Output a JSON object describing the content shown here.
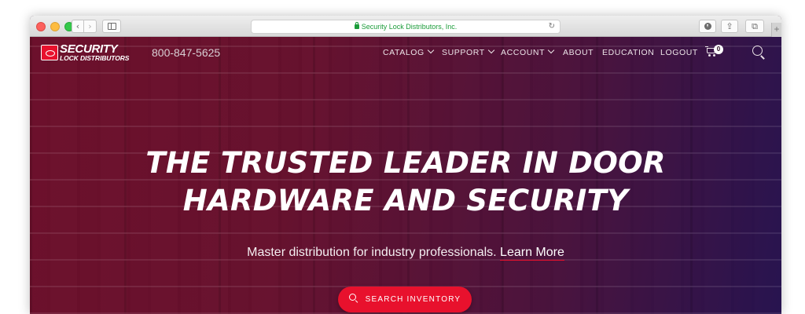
{
  "browser": {
    "url_text": "Security Lock Distributors, Inc.",
    "back_glyph": "‹",
    "forward_glyph": "›",
    "reload_glyph": "↻",
    "share_glyph": "⇪",
    "tabs_glyph": "⧉",
    "new_tab_glyph": "+"
  },
  "header": {
    "logo_top": "SECURITY",
    "logo_bottom": "LOCK DISTRIBUTORS",
    "phone": "800-847-5625",
    "nav": [
      {
        "label": "CATALOG",
        "has_dropdown": true
      },
      {
        "label": "SUPPORT",
        "has_dropdown": true
      },
      {
        "label": "ACCOUNT",
        "has_dropdown": true
      },
      {
        "label": "ABOUT",
        "has_dropdown": false
      },
      {
        "label": "EDUCATION",
        "has_dropdown": false
      },
      {
        "label": "LOGOUT",
        "has_dropdown": false
      }
    ],
    "cart_count": "0"
  },
  "hero": {
    "title_line1": "THE TRUSTED LEADER IN DOOR",
    "title_line2": "HARDWARE AND SECURITY",
    "subtitle": "Master distribution for industry professionals.",
    "learn_more": "Learn More",
    "cta_label": "SEARCH INVENTORY"
  },
  "colors": {
    "accent": "#e8112d",
    "hero_overlay_left": "#6e0e2a",
    "hero_overlay_right": "#241250"
  }
}
